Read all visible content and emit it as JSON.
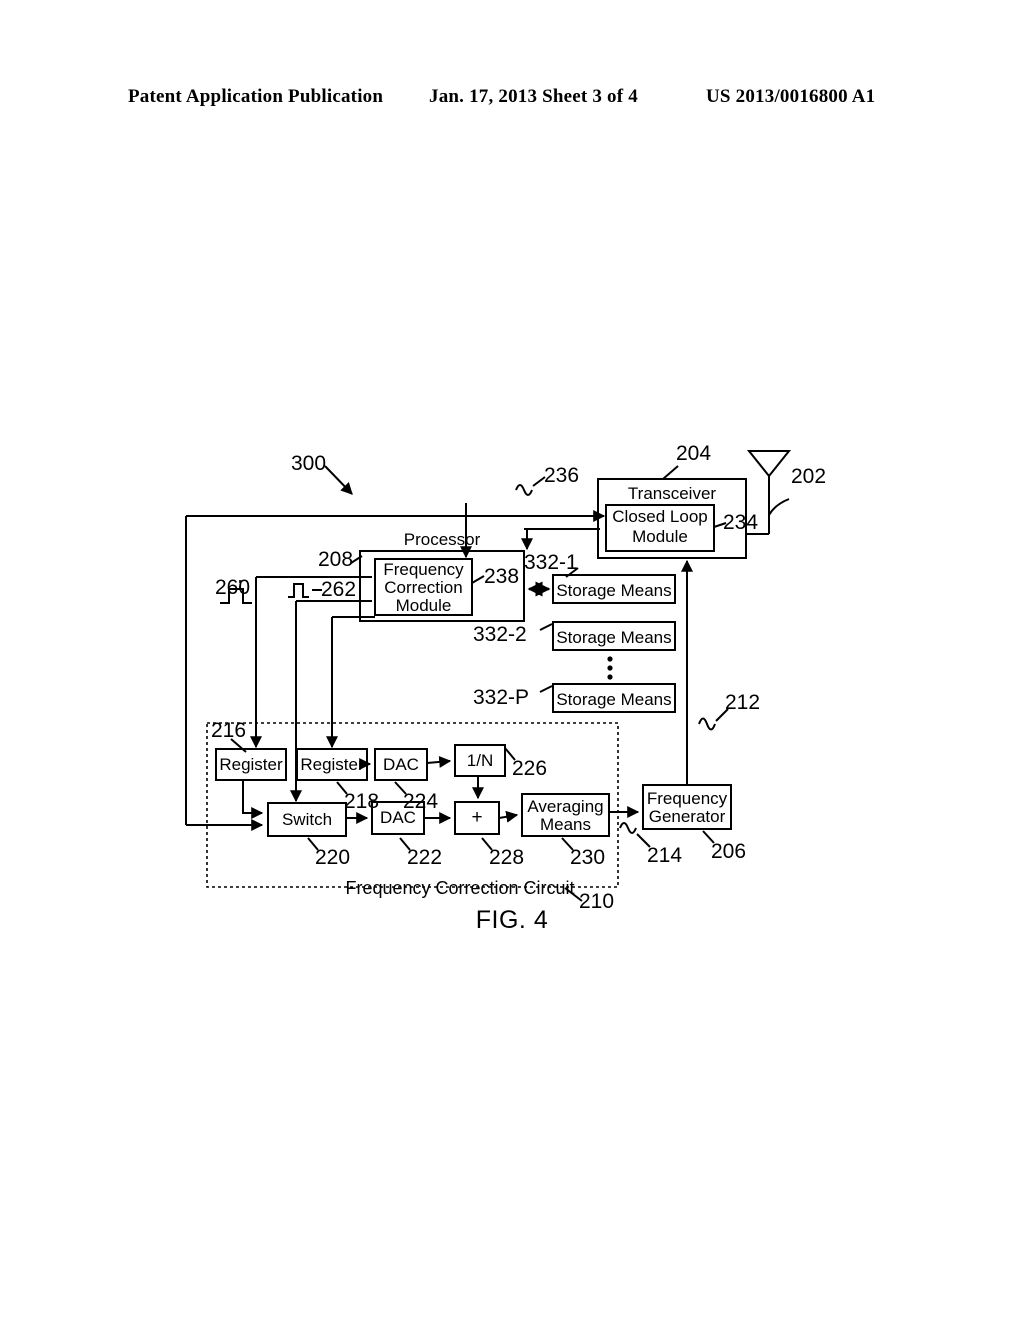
{
  "header": {
    "left": "Patent Application Publication",
    "middle": "Jan. 17, 2013  Sheet 3 of 4",
    "right": "US 2013/0016800 A1"
  },
  "figure": {
    "caption": "FIG. 4",
    "system_ref": "300",
    "circuit_boundary_label": "Frequency Correction Circuit",
    "circuit_boundary_ref": "210",
    "blocks": {
      "transceiver": {
        "label": "Transceiver",
        "ref": "204"
      },
      "closed_loop_module": {
        "label_line1": "Closed Loop",
        "label_line2": "Module",
        "ref": "234"
      },
      "antenna": {
        "ref": "202"
      },
      "processor": {
        "label": "Processor",
        "ref": "208"
      },
      "frequency_correction_module": {
        "label_line1": "Frequency",
        "label_line2": "Correction",
        "label_line3": "Module",
        "ref": "238"
      },
      "storage_means_1": {
        "label": "Storage Means",
        "ref": "332-1"
      },
      "storage_means_2": {
        "label": "Storage Means",
        "ref": "332-2"
      },
      "storage_means_p": {
        "label": "Storage Means",
        "ref": "332-P"
      },
      "register_1": {
        "label": "Register",
        "ref": "216"
      },
      "register_2": {
        "label": "Register",
        "ref": "218"
      },
      "switch": {
        "label": "Switch",
        "ref": "220"
      },
      "dac_lower": {
        "label": "DAC",
        "ref": "222"
      },
      "dac_upper": {
        "label": "DAC",
        "ref": "224"
      },
      "divider": {
        "label": "1/N",
        "ref": "226"
      },
      "adder": {
        "label": "+",
        "ref": "228"
      },
      "averaging_means": {
        "label_line1": "Averaging",
        "label_line2": "Means",
        "ref": "230"
      },
      "frequency_generator": {
        "label_line1": "Frequency",
        "label_line2": "Generator",
        "ref": "206"
      }
    },
    "signals": {
      "signal_236": {
        "ref": "236"
      },
      "signal_212": {
        "ref": "212"
      },
      "signal_214": {
        "ref": "214"
      },
      "pulse_260": {
        "ref": "260"
      },
      "pulse_262": {
        "ref": "262"
      }
    }
  },
  "colors": {
    "ink": "#000000",
    "paper": "#ffffff"
  }
}
